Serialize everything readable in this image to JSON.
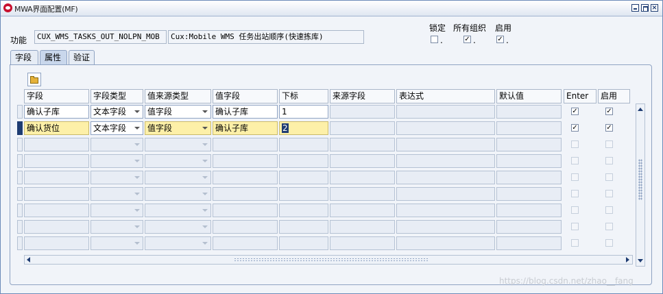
{
  "window": {
    "title": "MWA界面配置(MF)"
  },
  "form": {
    "function_label": "功能",
    "function_code": "CUX_WMS_TASKS_OUT_NOLPN_MOB",
    "function_desc": "Cux:Mobile WMS 任务出站顺序(快速拣库)",
    "flags": [
      {
        "label": "锁定",
        "checked": false
      },
      {
        "label": "所有组织",
        "checked": true
      },
      {
        "label": "启用",
        "checked": true
      }
    ]
  },
  "tabs": [
    "字段",
    "属性",
    "验证"
  ],
  "active_tab": 1,
  "table": {
    "columns": [
      "字段",
      "字段类型",
      "值来源类型",
      "值字段",
      "下标",
      "来源字段",
      "表达式",
      "默认值",
      "Enter",
      "启用"
    ],
    "rows": [
      {
        "field": "确认子库",
        "field_type": "文本字段",
        "source_type": "值字段",
        "value_field": "确认子库",
        "index": "1",
        "source_field": "",
        "expression": "",
        "default": "",
        "enter": true,
        "enabled": true
      },
      {
        "field": "确认货位",
        "field_type": "文本字段",
        "source_type": "值字段",
        "value_field": "确认子库",
        "index": "2",
        "source_field": "",
        "expression": "",
        "default": "",
        "enter": true,
        "enabled": true
      }
    ],
    "empty_rows": 7
  },
  "watermark": "https://blog.csdn.net/zhao__fang"
}
